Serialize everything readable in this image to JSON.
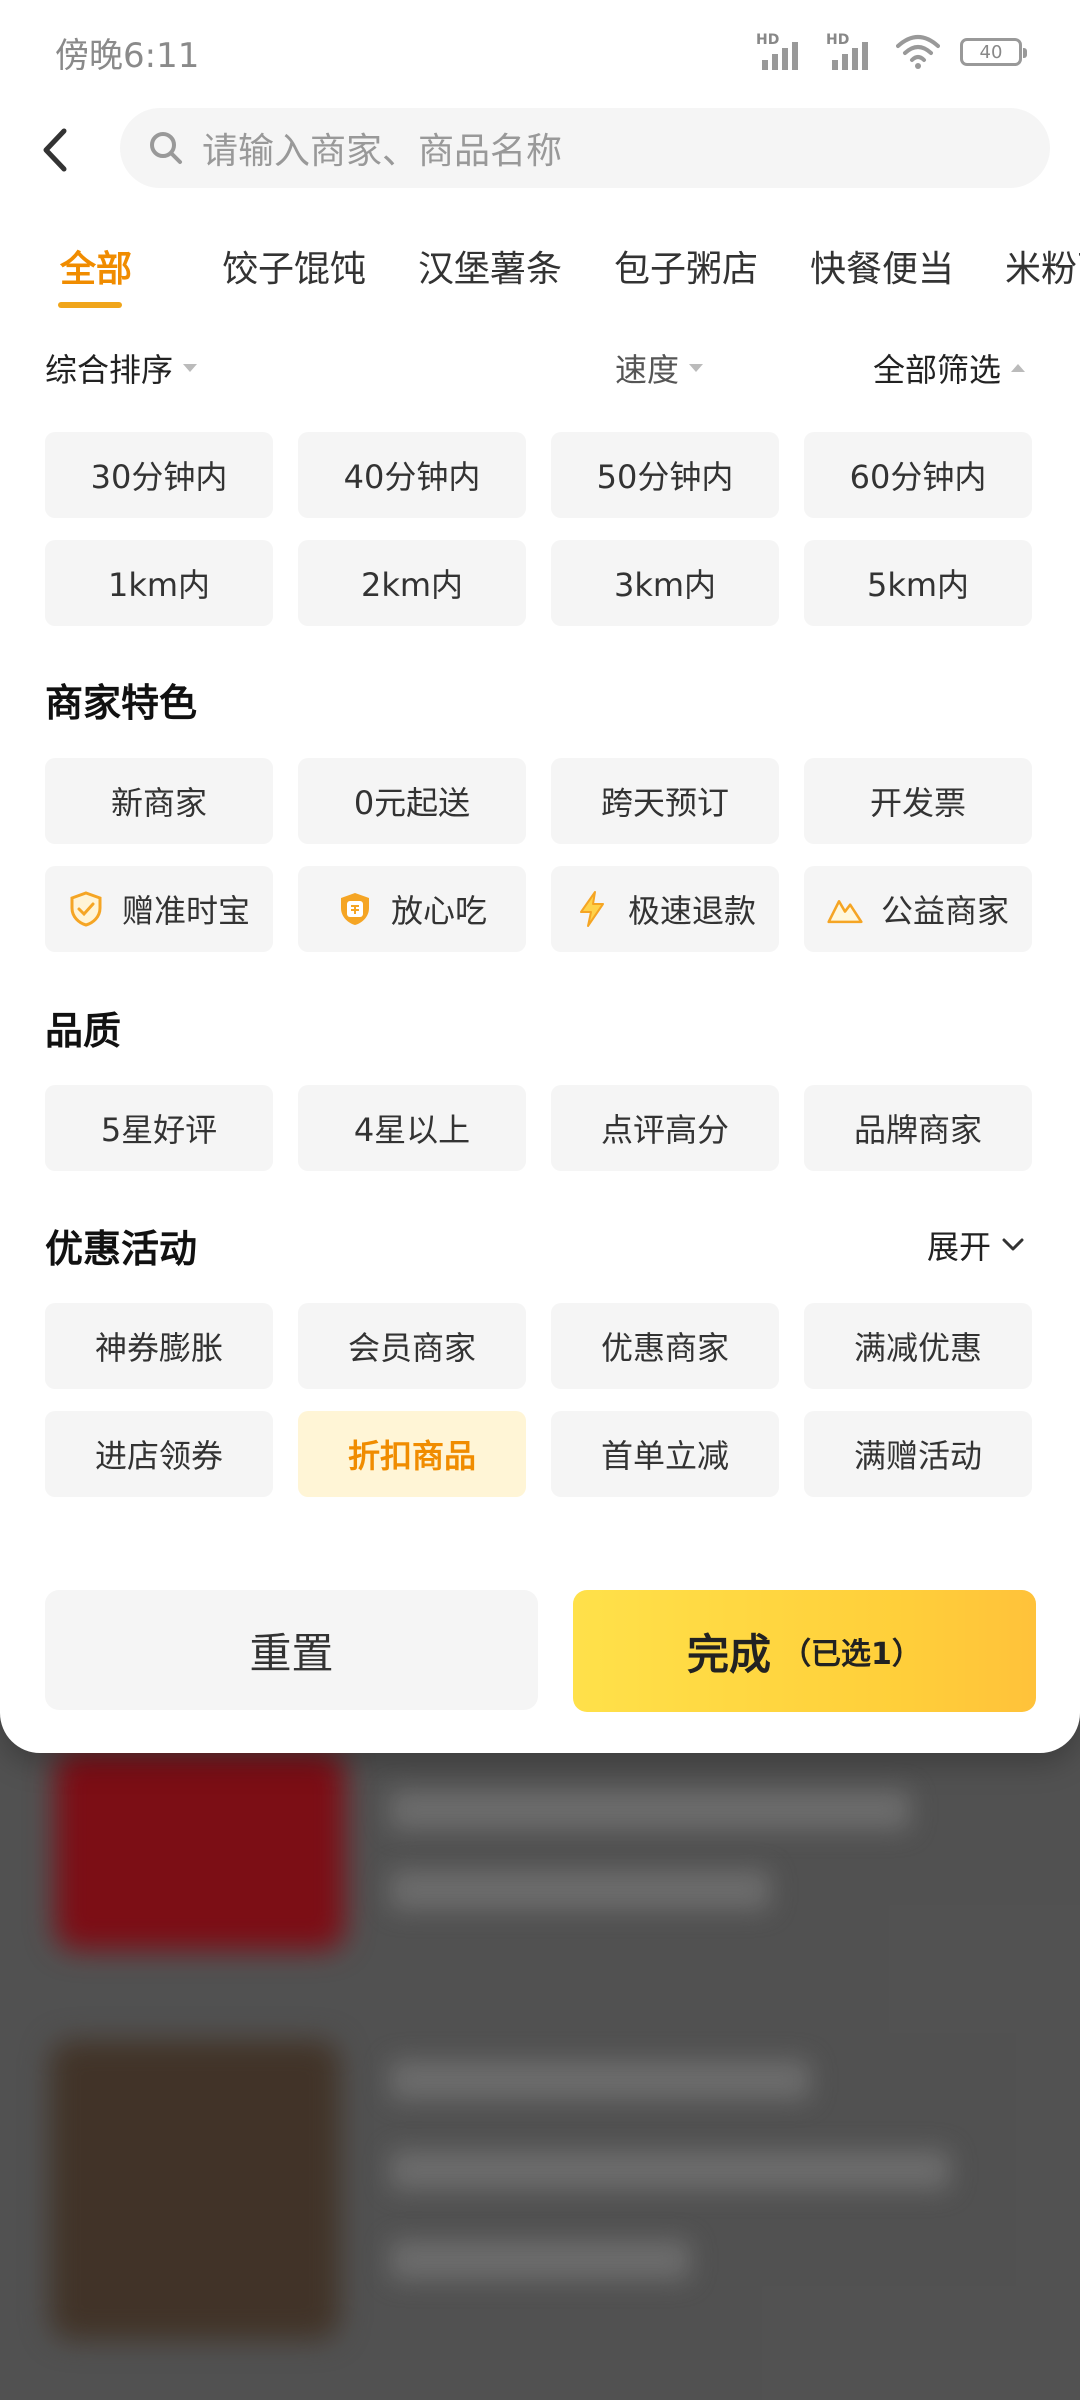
{
  "status_bar": {
    "time": "傍晚6:11",
    "battery": "40",
    "signal_label": "HD"
  },
  "search": {
    "placeholder": "请输入商家、商品名称"
  },
  "tabs": [
    "全部",
    "饺子馄饨",
    "汉堡薯条",
    "包子粥店",
    "快餐便当",
    "米粉面馆"
  ],
  "sort_row": {
    "sort": "综合排序",
    "speed": "速度",
    "all_filter": "全部筛选"
  },
  "time_chips": [
    "30分钟内",
    "40分钟内",
    "50分钟内",
    "60分钟内"
  ],
  "distance_chips": [
    "1km内",
    "2km内",
    "3km内",
    "5km内"
  ],
  "merchant_features": {
    "title": "商家特色",
    "row1": [
      "新商家",
      "0元起送",
      "跨天预订",
      "开发票"
    ],
    "row2": [
      {
        "label": "赠准时宝",
        "icon": "shield-check-icon"
      },
      {
        "label": "放心吃",
        "icon": "shield-bao-icon"
      },
      {
        "label": "极速退款",
        "icon": "lightning-icon"
      },
      {
        "label": "公益商家",
        "icon": "mountain-icon"
      }
    ]
  },
  "quality": {
    "title": "品质",
    "items": [
      "5星好评",
      "4星以上",
      "点评高分",
      "品牌商家"
    ]
  },
  "promotions": {
    "title": "优惠活动",
    "expand_label": "展开",
    "row1": [
      "神券膨胀",
      "会员商家",
      "优惠商家",
      "满减优惠"
    ],
    "row2": [
      "进店领券",
      "折扣商品",
      "首单立减",
      "满赠活动"
    ],
    "selected": "折扣商品"
  },
  "buttons": {
    "reset": "重置",
    "done": "完成",
    "done_count": "（已选1）"
  },
  "colors": {
    "accent": "#f08c00",
    "selected_bg": "#fff5d6",
    "done_button": "#ffd43a"
  }
}
